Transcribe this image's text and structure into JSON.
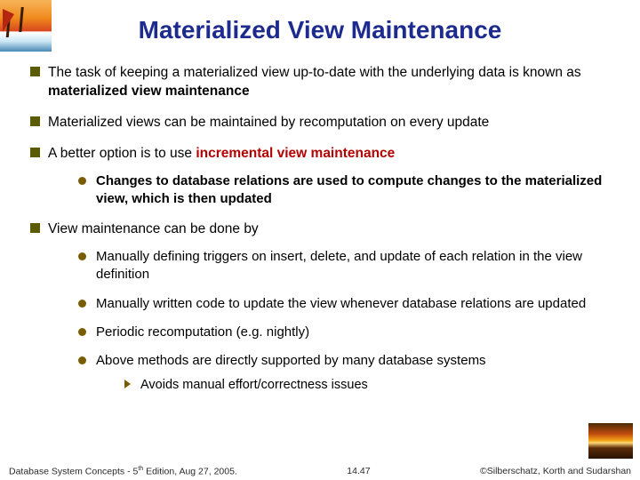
{
  "title": "Materialized View Maintenance",
  "bullets": {
    "b1a": "The task of keeping a materialized view up-to-date with the underlying data is known as ",
    "b1b": "materialized view maintenance",
    "b2": "Materialized views can be maintained by recomputation on every update",
    "b3a": "A better option is to use ",
    "b3b": "incremental view maintenance",
    "b3s1": "Changes to database relations are used to compute changes to the materialized view, which is then updated",
    "b4": "View maintenance can be done by",
    "b4s1": "Manually defining triggers on insert, delete, and update of each relation in the view definition",
    "b4s2": "Manually written code to update the view whenever database relations are updated",
    "b4s3": "Periodic recomputation (e.g. nightly)",
    "b4s4": "Above methods are directly supported by many database systems",
    "b4s4t1": "Avoids manual effort/correctness issues"
  },
  "footer": {
    "left_a": "Database System Concepts - 5",
    "left_b": " Edition, Aug 27, 2005.",
    "center": "14.47",
    "right": "©Silberschatz, Korth and Sudarshan"
  }
}
